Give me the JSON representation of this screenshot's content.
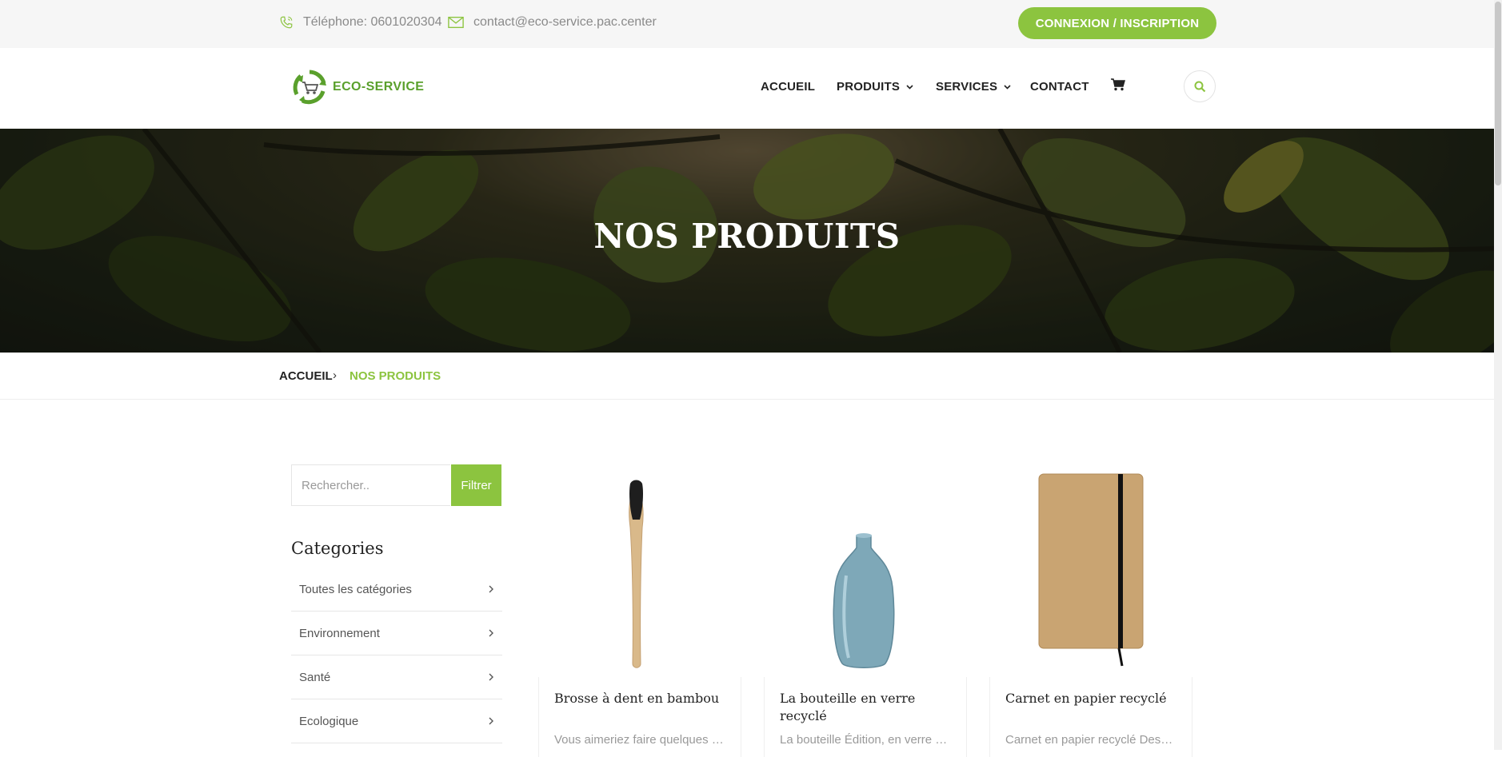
{
  "topbar": {
    "phone_text": "Téléphone: 0601020304",
    "email_text": "contact@eco-service.pac.center",
    "login_button": "CONNEXION / INSCRIPTION"
  },
  "header": {
    "logo_text": "ECO-SERVICE",
    "nav": [
      "ACCUEIL",
      "PRODUITS",
      "SERVICES",
      "CONTACT"
    ]
  },
  "hero": {
    "title": "NOS PRODUITS"
  },
  "breadcrumb": {
    "home": "ACCUEIL",
    "separator": "›",
    "current": "NOS PRODUITS"
  },
  "sidebar": {
    "search_placeholder": "Rechercher..",
    "filter_button": "Filtrer",
    "categories_title": "Categories",
    "categories": [
      "Toutes les catégories",
      "Environnement",
      "Santé",
      "Ecologique"
    ]
  },
  "products": [
    {
      "title": "Brosse à dent en bambou",
      "description": "Vous aimeriez faire quelques c..."
    },
    {
      "title": "La bouteille en verre recyclé",
      "description": "La bouteille Édition, en verre b..."
    },
    {
      "title": "Carnet en papier recyclé",
      "description": "Carnet en papier recyclé Descr..."
    }
  ],
  "colors": {
    "accent": "#8cc43f",
    "logo_green": "#5aa02c",
    "topbar_bg": "#f6f6f6"
  },
  "icons": [
    "phone-icon",
    "mail-icon",
    "cart-icon",
    "search-icon",
    "chevron-right-icon",
    "chevron-down-icon"
  ]
}
